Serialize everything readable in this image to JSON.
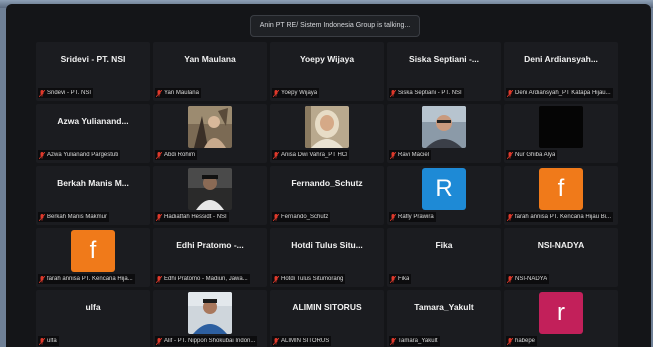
{
  "banner": {
    "talking_text": "Anin PT RE/ Sistem Indonesia Group is talking..."
  },
  "colors": {
    "orange_avatar": "#f07a1a",
    "blue_avatar": "#1e8ad6",
    "pink_avatar": "#c2205a",
    "muted_mic": "#e0392b"
  },
  "participants": [
    {
      "big": "Sridevi - PT. NSI",
      "label": "Sridevi - PT. NSI"
    },
    {
      "big": "Yan Maulana",
      "label": "Yan Maulana"
    },
    {
      "big": "Yoepy Wijaya",
      "label": "Yoepy Wijaya"
    },
    {
      "big": "Siska Septiani -...",
      "label": "Siska Septiani - PT. NSI"
    },
    {
      "big": "Deni Ardiansyah...",
      "label": "Deni Ardiansyah_PT Katapa Hijau..."
    },
    {
      "big": "Azwa Yulianand...",
      "label": "Azwa Yulianand Pargestuti"
    },
    {
      "big": "",
      "label": "Abdi Rohim"
    },
    {
      "big": "",
      "label": "Anisa Dwi Vahra_PT HCl"
    },
    {
      "big": "",
      "label": "Ravi Maciel"
    },
    {
      "big": "",
      "label": "Nur Ghiba Alya"
    },
    {
      "big": "Berkah Manis M...",
      "label": "Berkah Manis Makmur"
    },
    {
      "big": "",
      "label": "Hadiatfah Hessidt - NSI"
    },
    {
      "big": "Fernando_Schutz",
      "label": "Fernando_Schutz"
    },
    {
      "big": "",
      "letter": "R",
      "label": "Rafly Prawira"
    },
    {
      "big": "",
      "letter": "f",
      "label": "farah annisa PT. Kencana Hijau Bi..."
    },
    {
      "big": "",
      "letter": "f",
      "label": "farah annisa PT. Kencana Hija..."
    },
    {
      "big": "Edhi Pratomo -...",
      "label": "Edhi Pratomo - Madiun, Jawa..."
    },
    {
      "big": "Hotdi Tulus Situ...",
      "label": "Hotdi Tulus Situmorang"
    },
    {
      "big": "Fika",
      "label": "Fika"
    },
    {
      "big": "NSI-NADYA",
      "label": "NSI-NADYA"
    },
    {
      "big": "ulfa",
      "label": "ulfa"
    },
    {
      "big": "",
      "label": "Alif - PT. Nippon Shokubai Indon..."
    },
    {
      "big": "ALIMIN SITORUS",
      "label": "ALIMIN SITORUS"
    },
    {
      "big": "Tamara_Yakult",
      "label": "Tamara_Yakult"
    },
    {
      "big": "",
      "letter": "r",
      "label": "habepe"
    }
  ]
}
